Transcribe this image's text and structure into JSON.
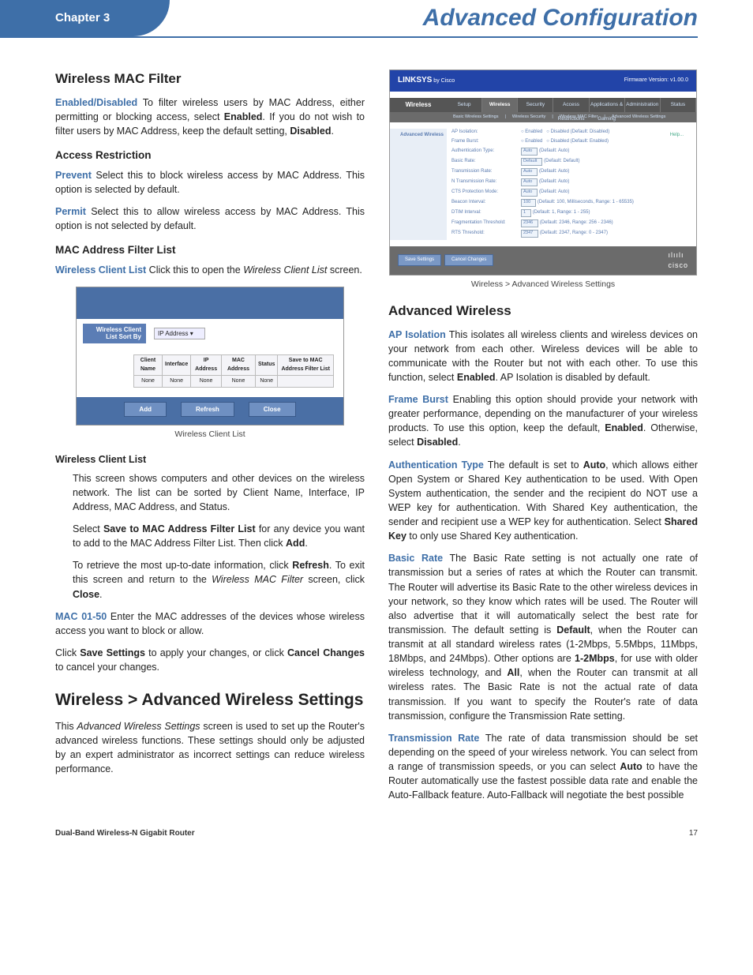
{
  "header": {
    "chapter": "Chapter 3",
    "title": "Advanced Configuration"
  },
  "left": {
    "h_mac_filter": "Wireless MAC Filter",
    "p_enabled": {
      "term": "Enabled/Disabled",
      "text_a": "  To filter wireless users by MAC Address, either permitting or blocking access, select ",
      "bold1": "Enabled",
      "text_b": ". If you do not wish to filter users by MAC Address, keep the default setting, ",
      "bold2": "Disabled",
      "text_c": "."
    },
    "h_access": "Access Restriction",
    "p_prevent": {
      "term": "Prevent",
      "text": " Select this to block wireless access by MAC Address. This option is selected by default."
    },
    "p_permit": {
      "term": "Permit",
      "text": " Select this to allow wireless access by MAC Address. This option is not selected by default."
    },
    "h_maclist": "MAC Address Filter List",
    "p_wcl": {
      "term": "Wireless Client List",
      "text_a": "  Click this to open the ",
      "ital": "Wireless Client List",
      "text_b": " screen."
    },
    "fig1": {
      "sort_label": "Wireless Client List\nSort By",
      "sort_opt": "IP Address",
      "cols": [
        "Client Name",
        "Interface",
        "IP Address",
        "MAC Address",
        "Status",
        "Save to MAC Address Filter List"
      ],
      "row": [
        "None",
        "None",
        "None",
        "None",
        "None",
        ""
      ],
      "btns": [
        "Add",
        "Refresh",
        "Close"
      ],
      "caption": "Wireless Client List"
    },
    "h_wcl2": "Wireless Client List",
    "p_wcl_desc": "This screen shows computers and other devices on the wireless network. The list can be sorted by Client Name, Interface, IP Address, MAC Address, and Status.",
    "p_save": {
      "a": "Select ",
      "b": "Save to MAC Address Filter List",
      "c": " for any device you want to add to the MAC Address Filter List. Then click ",
      "d": "Add",
      "e": "."
    },
    "p_refresh": {
      "a": "To retrieve the most up-to-date information, click ",
      "b": "Refresh",
      "c": ". To exit this screen and return to the ",
      "d": "Wireless MAC Filter",
      "e": " screen, click ",
      "f": "Close",
      "g": "."
    },
    "p_mac0150": {
      "term": "MAC 01-50",
      "text": " Enter the MAC addresses of the devices whose wireless access you want to block or allow."
    },
    "p_savecancel": {
      "a": "Click ",
      "b": "Save Settings",
      "c": " to apply your changes, or click ",
      "d": "Cancel Changes",
      "e": " to cancel your changes."
    },
    "h_advanced": "Wireless > Advanced Wireless Settings",
    "p_adv_intro": {
      "a": "This ",
      "b": "Advanced Wireless Settings",
      "c": " screen is used to set up the Router's advanced wireless functions. These settings should only be adjusted by an expert administrator as incorrect settings can reduce wireless performance."
    }
  },
  "right": {
    "fig2": {
      "brand": "LINKSYS",
      "by": "by Cisco",
      "fw": "Firmware Version: v1.00.0",
      "side": "Wireless",
      "tabs": [
        "Setup",
        "Wireless",
        "Security",
        "Access Restrictions",
        "Applications & Gaming",
        "Administration",
        "Status"
      ],
      "subtabs": [
        "Basic Wireless Settings",
        "Wireless Security",
        "Wireless MAC Filter",
        "Advanced Wireless Settings"
      ],
      "leftlabel": "Advanced Wireless",
      "rows": [
        {
          "lbl": "AP Isolation:",
          "val": "Enabled   Disabled  (Default: Disabled)",
          "radio": true
        },
        {
          "lbl": "Frame Burst:",
          "val": "Enabled   Disabled  (Default: Enabled)",
          "radio": true
        },
        {
          "lbl": "Authentication Type:",
          "val": "Auto",
          "hint": "(Default: Auto)"
        },
        {
          "lbl": "Basic Rate:",
          "val": "Default",
          "hint": "(Default: Default)"
        },
        {
          "lbl": "Transmission Rate:",
          "val": "Auto",
          "hint": "(Default: Auto)"
        },
        {
          "lbl": "N Transmission Rate:",
          "val": "Auto",
          "hint": "(Default: Auto)"
        },
        {
          "lbl": "CTS Protection Mode:",
          "val": "Auto",
          "hint": "(Default: Auto)"
        },
        {
          "lbl": "Beacon Interval:",
          "val": "100",
          "hint": "(Default: 100, Milliseconds, Range: 1 - 65535)"
        },
        {
          "lbl": "DTIM Interval:",
          "val": "1",
          "hint": "(Default: 1, Range: 1 - 255)"
        },
        {
          "lbl": "Fragmentation Threshold:",
          "val": "2346",
          "hint": "(Default: 2346, Range: 256 - 2346)"
        },
        {
          "lbl": "RTS Threshold:",
          "val": "2347",
          "hint": "(Default: 2347, Range: 0 - 2347)"
        }
      ],
      "help": "Help...",
      "btns": [
        "Save Settings",
        "Cancel Changes"
      ],
      "cisco": "cisco",
      "caption": "Wireless > Advanced Wireless Settings"
    },
    "h_advw": "Advanced Wireless",
    "p_ap": {
      "term": "AP Isolation",
      "a": "  This isolates all wireless clients and wireless devices on your network from each other. Wireless devices will be able to communicate with the Router but not with each other. To use this function, select ",
      "b": "Enabled",
      "c": ". AP Isolation is disabled by default."
    },
    "p_fb": {
      "term": "Frame Burst",
      "a": "  Enabling this option should provide your network with greater performance, depending on the manufacturer of your wireless products. To use this option, keep the default, ",
      "b": "Enabled",
      "c": ". Otherwise, select ",
      "d": "Disabled",
      "e": "."
    },
    "p_auth": {
      "term": "Authentication Type",
      "a": "  The default is set to ",
      "b": "Auto",
      "c": ", which allows either Open System or Shared Key authentication to be used. With Open System authentication, the sender and the recipient do NOT use a WEP key for authentication. With Shared Key authentication, the sender and recipient use a WEP key for authentication. Select ",
      "d": "Shared Key",
      "e": " to only use Shared Key authentication."
    },
    "p_basic": {
      "term": "Basic Rate",
      "a": "  The Basic Rate setting is not actually one rate of transmission but a series of rates at which the Router can transmit. The Router will advertise its Basic Rate to the other wireless devices in your network, so they know which rates will be used. The Router will also advertise that it will automatically select the best rate for transmission. The default setting is ",
      "b": "Default",
      "c": ", when the Router can transmit at all standard wireless rates (1-2Mbps, 5.5Mbps, 11Mbps, 18Mbps, and 24Mbps). Other options are ",
      "d": "1-2Mbps",
      "e": ", for use with older wireless technology, and ",
      "f": "All",
      "g": ", when the Router can transmit at all wireless rates. The Basic Rate is not the actual rate of data transmission. If you want to specify the Router's rate of data transmission, configure the Transmission Rate setting."
    },
    "p_tx": {
      "term": "Transmission Rate",
      "a": "  The rate of data transmission should be set depending on the speed of your wireless network. You can select from a range of transmission speeds, or you can select ",
      "b": "Auto",
      "c": " to have the Router automatically use the fastest possible data rate and enable the Auto-Fallback feature. Auto-Fallback will negotiate the best possible"
    }
  },
  "footer": {
    "left": "Dual-Band Wireless-N Gigabit Router",
    "right": "17"
  }
}
